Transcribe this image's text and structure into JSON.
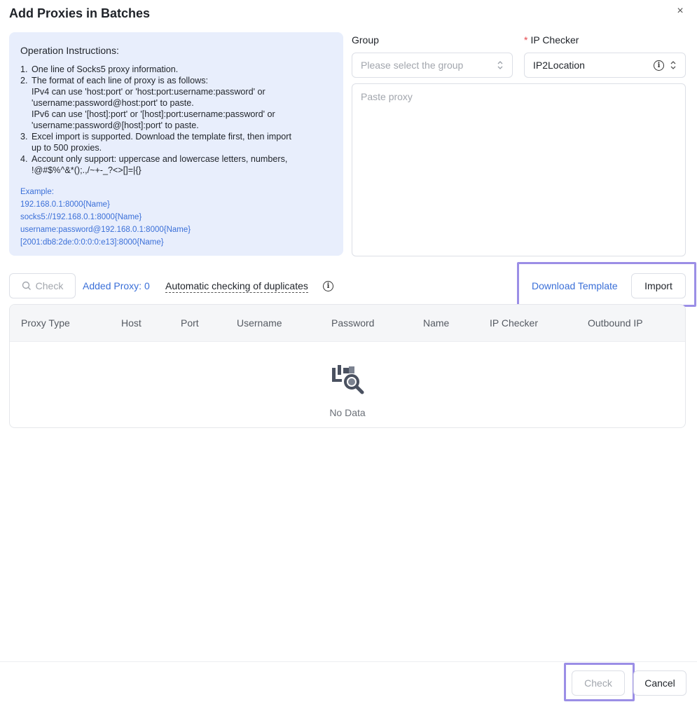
{
  "dialog": {
    "title": "Add Proxies in Batches",
    "close_label": "×"
  },
  "instructions": {
    "title": "Operation Instructions:",
    "items": [
      {
        "num": "1.",
        "text": "One line of Socks5 proxy information."
      },
      {
        "num": "2.",
        "text": "The format of each line of proxy is as follows:\nIPv4 can use 'host:port' or 'host:port:username:password' or\n'username:password@host:port' to paste.\nIPv6 can use '[host]:port' or '[host]:port:username:password' or\n'username:password@[host]:port' to paste."
      },
      {
        "num": "3.",
        "text": "Excel import is supported. Download the template first, then import\nup to 500 proxies."
      },
      {
        "num": "4.",
        "text": "Account only support: uppercase and lowercase letters, numbers,\n!@#$%^&*();.,/~+-_?<>[]=|{}"
      }
    ],
    "example_label": "Example:",
    "examples": [
      "192.168.0.1:8000{Name}",
      "socks5://192.168.0.1:8000{Name}",
      "username:password@192.168.0.1:8000{Name}",
      "[2001:db8:2de:0:0:0:0:e13]:8000{Name}"
    ]
  },
  "group": {
    "label": "Group",
    "placeholder": "Please select the group"
  },
  "ip_checker": {
    "required_mark": "*",
    "label": "IP Checker",
    "value": "IP2Location"
  },
  "proxy_input": {
    "placeholder": "Paste proxy"
  },
  "toolbar": {
    "check_label": "Check",
    "added_proxy_label": "Added Proxy: 0",
    "duplicates_label": "Automatic checking of duplicates",
    "download_template_label": "Download Template",
    "import_label": "Import"
  },
  "table": {
    "columns": [
      "Proxy Type",
      "Host",
      "Port",
      "Username",
      "Password",
      "Name",
      "IP Checker",
      "Outbound IP"
    ],
    "empty_text": "No Data"
  },
  "footer": {
    "check_label": "Check",
    "cancel_label": "Cancel"
  },
  "colors": {
    "accent": "#3a6fd8",
    "highlight": "#9b8ee6",
    "panel_bg": "#e8eefc",
    "required": "#e5484d"
  }
}
